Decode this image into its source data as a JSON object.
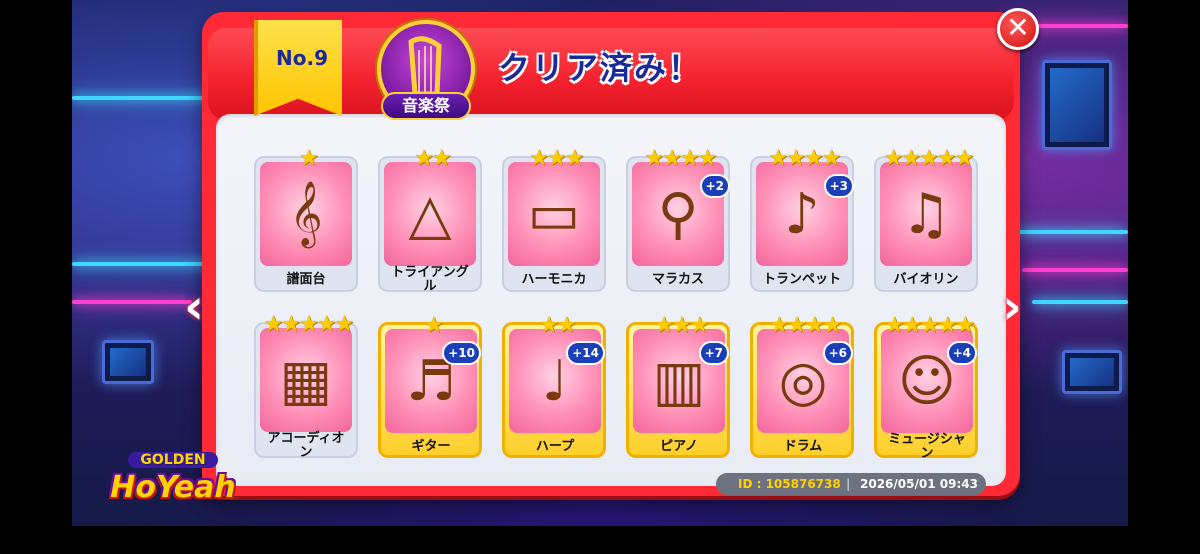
{
  "header": {
    "no_label": "No.9",
    "badge_label": "音楽祭",
    "title": "クリア済み！",
    "close_glyph": "✕"
  },
  "nav": {
    "prev_glyph": "‹",
    "next_glyph": "›"
  },
  "cards": [
    {
      "label": "譜面台",
      "stars": 1,
      "plus": "",
      "gold": false,
      "icon": "music-stand-icon"
    },
    {
      "label": "トライアング\nル",
      "stars": 2,
      "plus": "",
      "gold": false,
      "icon": "triangle-icon"
    },
    {
      "label": "ハーモニカ",
      "stars": 3,
      "plus": "",
      "gold": false,
      "icon": "harmonica-icon"
    },
    {
      "label": "マラカス",
      "stars": 4,
      "plus": "+2",
      "gold": false,
      "icon": "maracas-icon"
    },
    {
      "label": "トランペット",
      "stars": 4,
      "plus": "+3",
      "gold": false,
      "icon": "trumpet-icon"
    },
    {
      "label": "バイオリン",
      "stars": 5,
      "plus": "",
      "gold": false,
      "icon": "violin-icon"
    },
    {
      "label": "アコーディオ\nン",
      "stars": 5,
      "plus": "",
      "gold": false,
      "icon": "accordion-icon"
    },
    {
      "label": "ギター",
      "stars": 1,
      "plus": "+10",
      "gold": true,
      "icon": "guitar-icon"
    },
    {
      "label": "ハープ",
      "stars": 2,
      "plus": "+14",
      "gold": true,
      "icon": "harp-icon"
    },
    {
      "label": "ピアノ",
      "stars": 3,
      "plus": "+7",
      "gold": true,
      "icon": "piano-icon"
    },
    {
      "label": "ドラム",
      "stars": 4,
      "plus": "+6",
      "gold": true,
      "icon": "drum-icon"
    },
    {
      "label": "ミュージシャ\nン",
      "stars": 5,
      "plus": "+4",
      "gold": true,
      "icon": "conductor-icon"
    }
  ],
  "footer": {
    "id_text": "ID : 105876738",
    "divider": "|",
    "timestamp": "2026/05/01 09:43"
  },
  "logo": {
    "top": "GOLDEN",
    "main": "HoYeah"
  }
}
